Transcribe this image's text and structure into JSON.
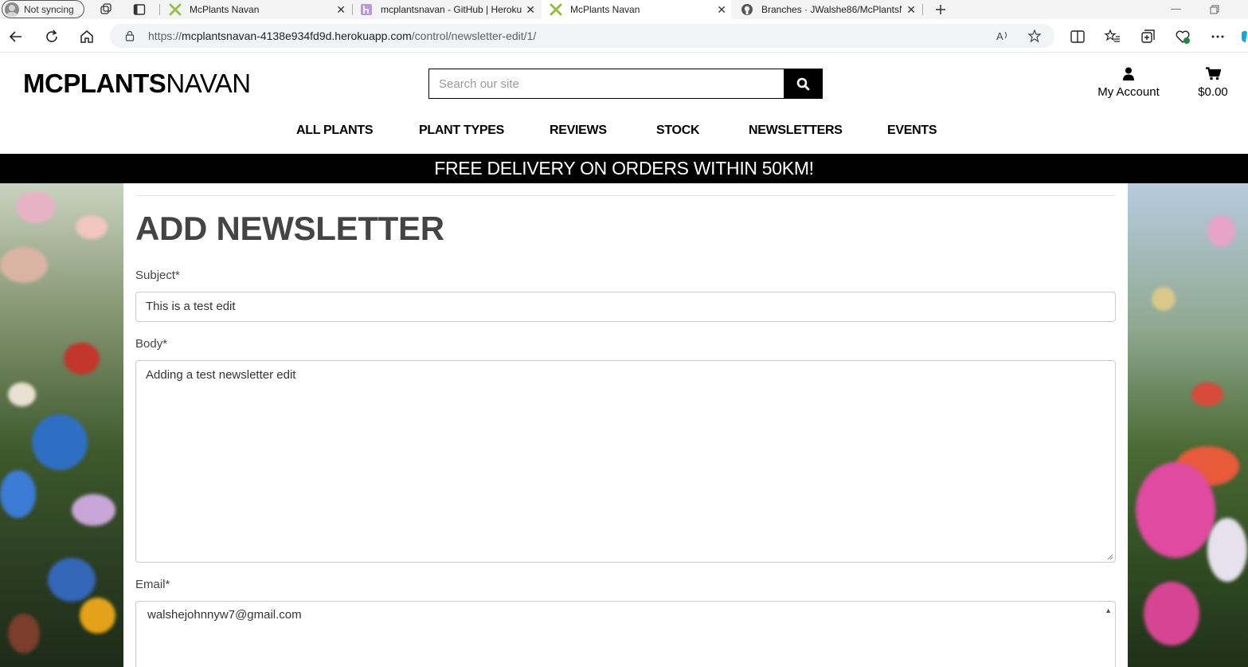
{
  "browser": {
    "profile_label": "Not syncing",
    "tabs": [
      {
        "title": "McPlants Navan",
        "active": false
      },
      {
        "title": "mcplantsnavan - GitHub | Heroku",
        "active": false
      },
      {
        "title": "McPlants Navan",
        "active": true
      },
      {
        "title": "Branches · JWalshe86/McPlantsN",
        "active": false
      }
    ],
    "url_scheme": "https://",
    "url_host": "mcplantsnavan-4138e934fd9d.herokuapp.com",
    "url_path": "/control/newsletter-edit/1/",
    "icons": [
      "back-icon",
      "reload-icon",
      "home-icon",
      "lock-icon",
      "read-aloud-icon",
      "favorite-star-icon",
      "split-screen-icon",
      "favorites-icon",
      "collections-icon",
      "browser-essentials-icon",
      "more-icon",
      "copilot-icon"
    ]
  },
  "site": {
    "logo_bold": "MCPLANTS",
    "logo_light": "NAVAN",
    "search_placeholder": "Search our site",
    "account_label": "My Account",
    "cart_total": "$0.00",
    "nav": [
      "ALL PLANTS",
      "PLANT TYPES",
      "REVIEWS",
      "STOCK",
      "NEWSLETTERS",
      "EVENTS"
    ],
    "banner": "FREE DELIVERY ON ORDERS WITHIN 50KM!"
  },
  "form": {
    "title": "ADD NEWSLETTER",
    "subject_label": "Subject*",
    "subject_value": "This is a test edit",
    "body_label": "Body*",
    "body_value": "Adding a test newsletter edit",
    "email_label": "Email*",
    "email_value": "walshejohnnyw7@gmail.com"
  },
  "colors": {
    "banner_bg": "#000000",
    "banner_text": "#ffffff",
    "title_text": "#444444",
    "tab_bar_bg": "#f3f3f3"
  }
}
